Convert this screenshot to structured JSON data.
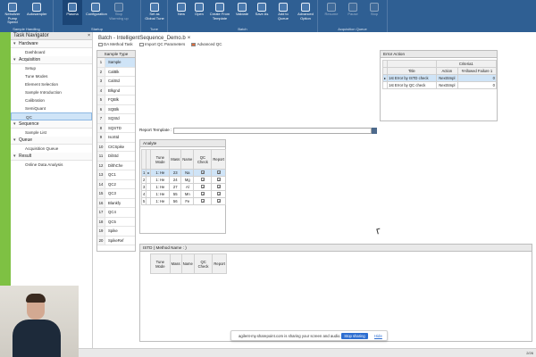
{
  "ribbon": {
    "groups": [
      {
        "label": "Sample Handling",
        "buttons": [
          {
            "label": "Nebulizer Pump Speed",
            "state": "normal"
          },
          {
            "label": "Autosampler",
            "state": "normal"
          }
        ]
      },
      {
        "label": "Startup",
        "buttons": [
          {
            "label": "Plasma",
            "state": "active"
          },
          {
            "label": "Configuration",
            "state": "normal"
          },
          {
            "label": "Stop Warming up",
            "state": "disabled"
          }
        ]
      },
      {
        "label": "Tune",
        "buttons": [
          {
            "label": "Set as Global Tune",
            "state": "normal"
          }
        ]
      },
      {
        "label": "Batch",
        "buttons": [
          {
            "label": "New",
            "state": "normal"
          },
          {
            "label": "Open",
            "state": "normal"
          },
          {
            "label": "Create From Template",
            "state": "normal"
          },
          {
            "label": "Validate",
            "state": "normal"
          },
          {
            "label": "Save As",
            "state": "normal"
          },
          {
            "label": "Add to Queue",
            "state": "normal"
          },
          {
            "label": "Advanced Option",
            "state": "normal"
          }
        ]
      },
      {
        "label": "Acquisition Queue",
        "buttons": [
          {
            "label": "Resume",
            "state": "disabled"
          },
          {
            "label": "Pause",
            "state": "disabled"
          },
          {
            "label": "Stop",
            "state": "disabled"
          }
        ]
      }
    ]
  },
  "nav": {
    "title": "Task Navigator",
    "close": "×",
    "sections": [
      {
        "label": "Hardware",
        "items": [
          {
            "label": "Dashboard",
            "selected": false
          }
        ]
      },
      {
        "label": "Acquisition",
        "items": [
          {
            "label": "Setup",
            "selected": false
          },
          {
            "label": "Tune Modes",
            "selected": false
          },
          {
            "label": "Element Selection",
            "selected": false
          },
          {
            "label": "Sample Introduction",
            "selected": false
          },
          {
            "label": "Calibration",
            "selected": false
          },
          {
            "label": "SemiQuant",
            "selected": false
          },
          {
            "label": "QC",
            "selected": true
          }
        ]
      },
      {
        "label": "Sequence",
        "items": [
          {
            "label": "Sample List",
            "selected": false
          }
        ]
      },
      {
        "label": "Queue",
        "items": [
          {
            "label": "Acquisition Queue",
            "selected": false
          }
        ]
      },
      {
        "label": "Result",
        "items": [
          {
            "label": "Online Data Analysis",
            "selected": false
          }
        ]
      }
    ]
  },
  "main": {
    "tab_title": "Batch - IntelligentSequence_Demo.b",
    "tab_close": "×",
    "subtools": [
      "DA Method Task",
      "Import QC Parameters",
      "Advanced QC"
    ],
    "sample_type": {
      "header": "Sample Type",
      "rows": [
        "Sample",
        "CalBlk",
        "CalStd",
        "Blkgnd",
        "FQBlk",
        "SQBlk",
        "SQStd",
        "SQSTD",
        "IsoStd",
        "CICSpike",
        "DilStd",
        "DilthChe",
        "QC1",
        "QC2",
        "QC3",
        "Blankfy",
        "QC4",
        "QC5",
        "Spike",
        "SpikeRef"
      ]
    },
    "report_template": {
      "label": "Report Template :",
      "value": ""
    },
    "error_action": {
      "title": "Error Action",
      "group_header": "Criteria1",
      "columns": [
        "Title",
        "Action",
        "#Allowed Failure 1"
      ],
      "rows": [
        {
          "title": "1st Error by ISTD check",
          "action": "NextSmpl",
          "allowed": "0",
          "selected": true
        },
        {
          "title": "1st Error by QC check",
          "action": "NextSmpl",
          "allowed": "0",
          "selected": false
        }
      ]
    },
    "analyte": {
      "title": "Analyte",
      "columns": [
        "Tune Mode",
        "Mass",
        "Name",
        "QC Check",
        "Report"
      ],
      "rows": [
        {
          "n": "1",
          "tune": "1: He",
          "mass": "23",
          "name": "Na",
          "qc": "✓",
          "report": "✓",
          "selected": true
        },
        {
          "n": "2",
          "tune": "1: He",
          "mass": "24",
          "name": "Mg",
          "qc": "✓",
          "report": "✓",
          "selected": false
        },
        {
          "n": "3",
          "tune": "1: He",
          "mass": "27",
          "name": "Al",
          "qc": "✓",
          "report": "✓",
          "selected": false
        },
        {
          "n": "4",
          "tune": "1: He",
          "mass": "55",
          "name": "Mn",
          "qc": "✓",
          "report": "✓",
          "selected": false
        },
        {
          "n": "5",
          "tune": "1: He",
          "mass": "56",
          "name": "Fe",
          "qc": "✓",
          "report": "✓",
          "selected": false
        }
      ]
    },
    "istd": {
      "title": "ISTD ( Method Name : )",
      "columns": [
        "Tune Mode",
        "Mass",
        "Name",
        "QC Check",
        "Report"
      ]
    }
  },
  "share_bar": {
    "message": "agilent-my.sharepoint.com is sharing your screen and audio.",
    "stop_label": "Stop sharing",
    "hide_label": "Hide"
  },
  "taskbar": {
    "clock": "2/26"
  },
  "colors": {
    "ribbon": "#2f5f93",
    "green_bar": "#7ec143",
    "selection": "#cfe4f7",
    "share_button": "#2d6ed1"
  }
}
